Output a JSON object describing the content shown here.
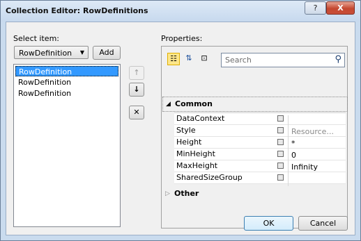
{
  "window": {
    "title": "Collection Editor: RowDefinitions",
    "help_label": "?",
    "close_label": "X"
  },
  "left": {
    "select_label": "Select item:",
    "combo_value": "RowDefinition",
    "add_label": "Add",
    "items": [
      "RowDefinition",
      "RowDefinition",
      "RowDefinition"
    ],
    "selected_index": 0
  },
  "move": {
    "up_label": "↑",
    "down_label": "↓",
    "remove_label": "✕"
  },
  "properties": {
    "label": "Properties:",
    "search_placeholder": "Search",
    "category_common": "Common",
    "category_other": "Other",
    "collapse_glyph": "◢",
    "expand_glyph": "▷",
    "rows": [
      {
        "name": "DataContext",
        "value": ""
      },
      {
        "name": "Style",
        "value": "Resource..."
      },
      {
        "name": "Height",
        "value": "*"
      },
      {
        "name": "MinHeight",
        "value": "0"
      },
      {
        "name": "MaxHeight",
        "value": "Infinity"
      },
      {
        "name": "SharedSizeGroup",
        "value": ""
      }
    ]
  },
  "footer": {
    "ok_label": "OK",
    "cancel_label": "Cancel"
  }
}
